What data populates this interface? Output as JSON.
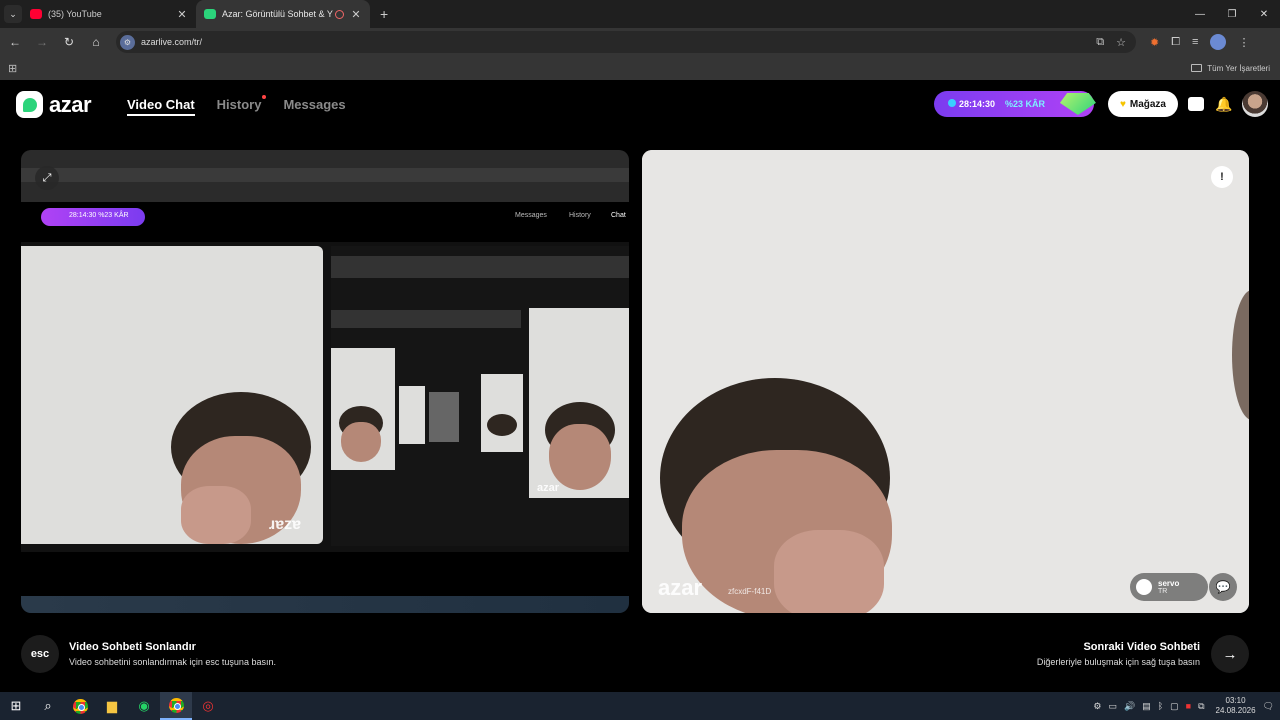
{
  "browser": {
    "tabs": [
      {
        "title": "(35) YouTube",
        "favicon_color": "#ff0033",
        "active": false
      },
      {
        "title": "Azar: Görüntülü Sohbet & Y",
        "favicon_color": "#2bd47b",
        "active": true
      }
    ],
    "new_tab": "+",
    "url": "azarlive.com/tr/",
    "bookmarks_all": "Tüm Yer İşaretleri"
  },
  "azar": {
    "logo_text": "azar",
    "nav": [
      {
        "label": "Video Chat",
        "active": true
      },
      {
        "label": "History",
        "active": false,
        "dot": true
      },
      {
        "label": "Messages",
        "active": false
      }
    ],
    "promo": {
      "timer": "28:14:30",
      "discount": "%23 KÂR"
    },
    "store_label": "Mağaza",
    "mirror": {
      "nav_chat": "Chat",
      "nav_history": "History",
      "nav_messages": "Messages",
      "promo_text": "28:14:30  %23 KÂR"
    },
    "partner": {
      "name": "servo",
      "country": "TR",
      "uid": "zfcxdF-f41D"
    },
    "end_chat": {
      "key": "esc",
      "title": "Video Sohbeti Sonlandır",
      "desc": "Video sohbetini sonlandırmak için esc tuşuna basın."
    },
    "next_chat": {
      "title": "Sonraki Video Sohbeti",
      "desc": "Diğerleriyle buluşmak için sağ tuşa basın"
    }
  },
  "taskbar": {
    "time": "03:10",
    "date": "24.08.2026"
  },
  "colors": {
    "accent_green": "#2bd47b",
    "promo_purple": "#8b3cf2",
    "page_bg": "#000000"
  }
}
